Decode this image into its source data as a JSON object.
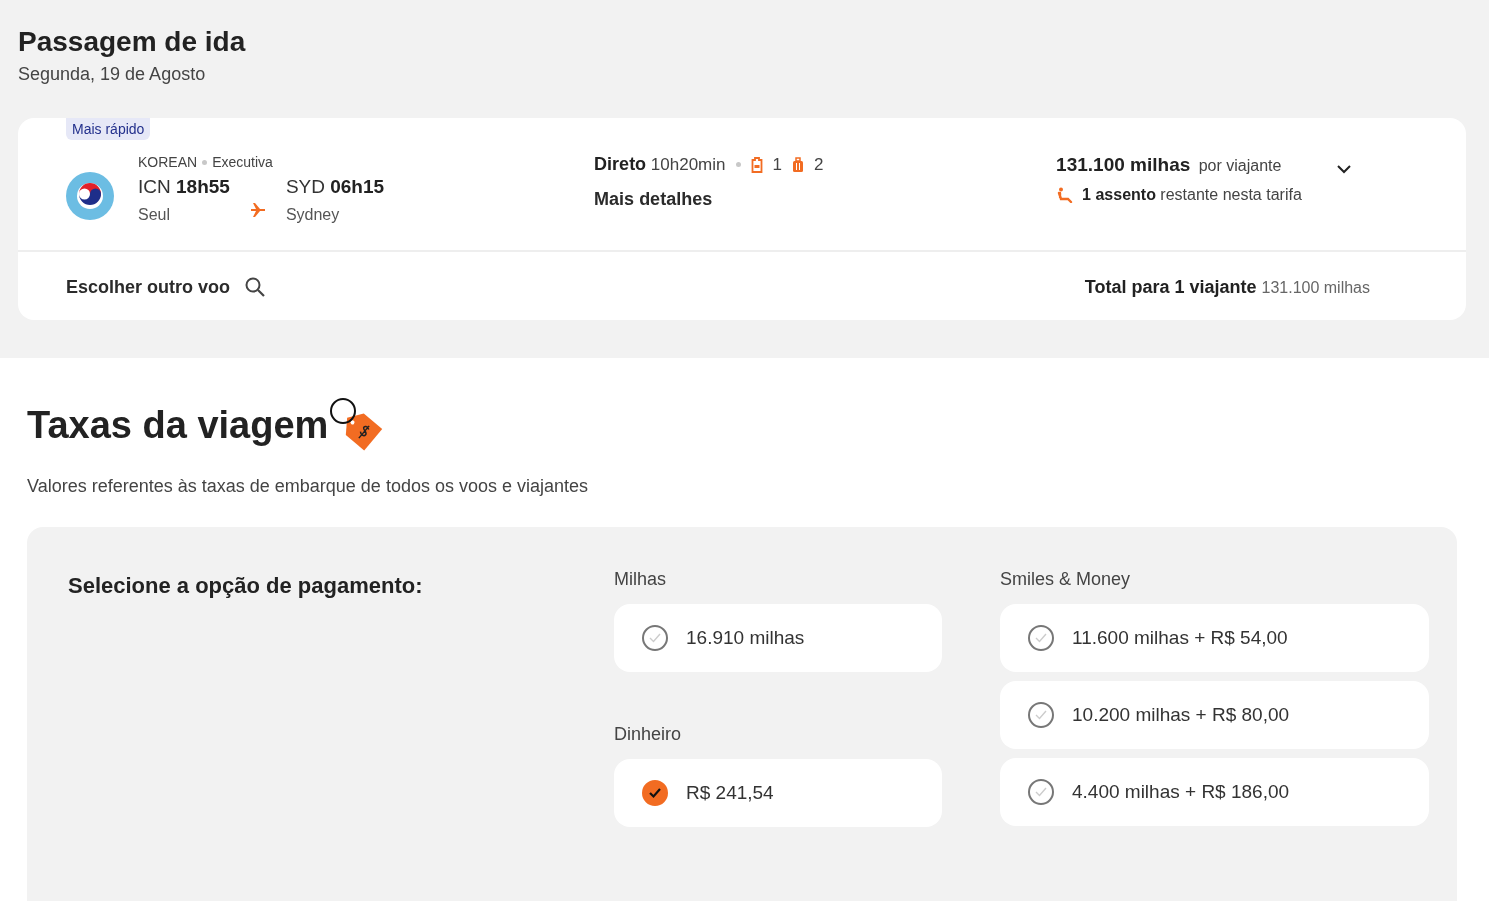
{
  "outbound": {
    "title": "Passagem de ida",
    "date": "Segunda, 19 de Agosto"
  },
  "flight": {
    "badge": "Mais rápido",
    "airline": "KOREAN",
    "cabin": "Executiva",
    "origin": {
      "code": "ICN",
      "time": "18h55",
      "city": "Seul"
    },
    "destination": {
      "code": "SYD",
      "time": "06h15",
      "city": "Sydney"
    },
    "stops": "Direto",
    "duration": "10h20min",
    "carry_on": "1",
    "checked_bags": "2",
    "details_link": "Mais detalhes",
    "price": "131.100 milhas",
    "price_unit": "por viajante",
    "seats_bold": "1 assento",
    "seats_text": "restante nesta tarifa",
    "expanded": false,
    "change_flight": "Escolher outro voo",
    "total_label": "Total para 1 viajante",
    "total_value": "131.100 milhas"
  },
  "fees": {
    "title": "Taxas da viagem",
    "subtitle": "Valores referentes às taxas de embarque de todos os voos e viajantes",
    "payment_label": "Selecione a opção de pagamento:",
    "columns": [
      {
        "groups": [
          {
            "label": "Milhas",
            "options": [
              {
                "text": "16.910 milhas",
                "selected": false
              }
            ]
          },
          {
            "label": "Dinheiro",
            "options": [
              {
                "text": "R$ 241,54",
                "selected": true
              }
            ]
          }
        ]
      },
      {
        "groups": [
          {
            "label": "Smiles & Money",
            "options": [
              {
                "text": "11.600 milhas + R$ 54,00",
                "selected": false
              },
              {
                "text": "10.200 milhas + R$ 80,00",
                "selected": false
              },
              {
                "text": "4.400 milhas + R$ 186,00",
                "selected": false
              }
            ]
          }
        ]
      }
    ]
  }
}
